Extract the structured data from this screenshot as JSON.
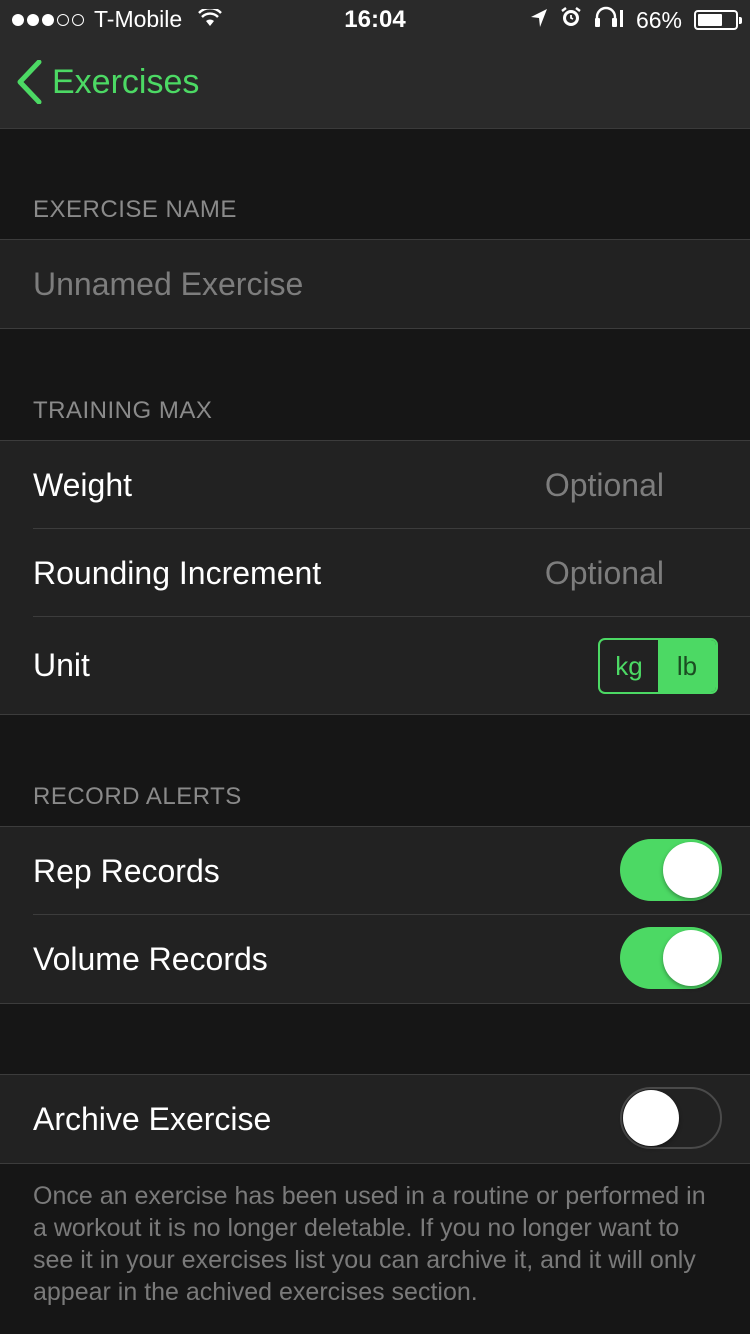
{
  "status_bar": {
    "carrier": "T-Mobile",
    "time": "16:04",
    "battery_percent_label": "66%",
    "battery_level": 0.66,
    "signal_dots_filled": 3,
    "signal_dots_total": 5
  },
  "nav": {
    "back_label": "Exercises",
    "accent_color": "#4cd964"
  },
  "exercise_name": {
    "header": "EXERCISE NAME",
    "placeholder": "Unnamed Exercise"
  },
  "training_max": {
    "header": "TRAINING MAX",
    "weight_label": "Weight",
    "weight_placeholder": "Optional",
    "rounding_label": "Rounding Increment",
    "rounding_placeholder": "Optional",
    "unit_label": "Unit",
    "unit_options": [
      "kg",
      "lb"
    ],
    "unit_selected": "lb"
  },
  "record_alerts": {
    "header": "RECORD ALERTS",
    "rep_label": "Rep Records",
    "rep_enabled": true,
    "volume_label": "Volume Records",
    "volume_enabled": true
  },
  "archive": {
    "label": "Archive Exercise",
    "enabled": false,
    "note": "Once an exercise has been used in a routine or performed in a workout it is no longer deletable. If you no longer want to see it in your exercises list you can archive it, and it will only appear in the achived exercises section."
  }
}
